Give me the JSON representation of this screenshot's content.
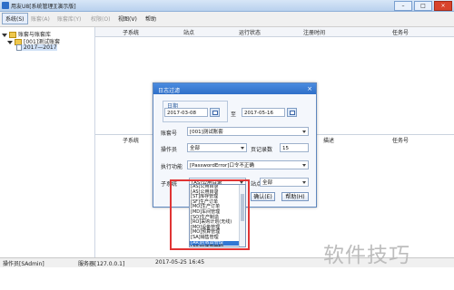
{
  "window": {
    "title": "用友U8[系统管理][演示版]"
  },
  "menu": [
    {
      "label": "系统(S)",
      "state": "active"
    },
    {
      "label": "账套(A)",
      "state": "disabled"
    },
    {
      "label": "账套库(Y)",
      "state": "disabled"
    },
    {
      "label": "权限(O)",
      "state": "disabled"
    },
    {
      "label": "视图(V)",
      "state": "normal"
    },
    {
      "label": "帮助",
      "state": "normal"
    }
  ],
  "tree": {
    "root": "账套与账套库",
    "child": "[001]测试账套",
    "grandchild": "2017—2017"
  },
  "grid_upper": {
    "columns": [
      "子系统",
      "站点",
      "运行状态",
      "注册时间",
      "任务号"
    ]
  },
  "grid_lower": {
    "columns": [
      "子系统",
      "站点",
      "描述",
      "任务号"
    ]
  },
  "dialog": {
    "title": "日志过滤",
    "date_group_label": "日期",
    "date_from": "2017-03-08",
    "date_to_label": "至",
    "date_to": "2017-05-16",
    "account_label": "账套号",
    "account_value": "[001]测试账套",
    "operator_label": "操作员",
    "operator_value": "全部",
    "page_records_label": "页记录数",
    "page_records_value": "15",
    "exec_func_label": "执行功能",
    "exec_func_value": "[PasswordError]口令不正确",
    "subsystem_label": "子系统",
    "subsystem_value": "[AS]公用目录",
    "site_label": "站点",
    "site_value": "全部",
    "ok_label": "确认(E)",
    "help_label": "帮助(H)"
  },
  "dropdown": {
    "items": [
      "[AS]公用目录",
      "[AS]公用目录",
      "[ST]库存管理",
      "[SF]生产订单",
      "[MO]生产订单",
      "[MD]车间管理",
      "[SO]生产制造",
      "[RO]采购计划(无线)",
      "[MO]设备管理",
      "[MO]预算管理",
      "[SA]销售管理",
      "[AR]应收款管理",
      "[AR]应收款管理"
    ],
    "selected_index": 11
  },
  "status": {
    "operator": "操作员[SAdmin]",
    "server": "服务器[127.0.0.1]",
    "datetime": "2017-05-25 16:45"
  },
  "watermark": "软件技巧"
}
